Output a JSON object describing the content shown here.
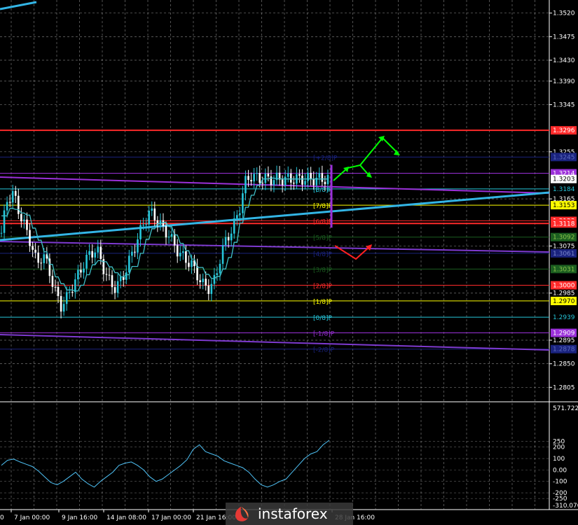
{
  "colors": {
    "background": "#000000",
    "grid": "#c0c0c0",
    "axis_text": "#ffffff",
    "candle_up": "#26c6da",
    "candle_down": "#ffffff",
    "ma": "#3fc0c8",
    "trend_cyan": "#33b5e5",
    "channel_purple": "#9b30d9",
    "level_red": "#ff2a2a",
    "forecast_green": "#00ff00",
    "forecast_red": "#ff2020",
    "cci": "#4fc3f7"
  },
  "chart_data": [
    {
      "type": "line",
      "title": "",
      "xlabel": "",
      "ylabel": "",
      "ylim": [
        1.278,
        1.3545
      ],
      "price_ticks": [
        "1.3520",
        "1.3475",
        "1.3430",
        "1.3390",
        "1.3345",
        "1.3255",
        "1.3165",
        "1.3075",
        "1.2985",
        "1.2895",
        "1.2850",
        "1.2805"
      ],
      "time_ticks": [
        "7 Jan 00:00",
        "9 Jan 16:00",
        "14 Jan 08:00",
        "17 Jan 00:00",
        "21 Jan 16:00",
        "28 Jan 16:00"
      ],
      "time_first_label": "0",
      "grid": true,
      "close_series": {
        "name": "",
        "x": [
          0,
          2,
          4,
          6,
          8,
          10,
          12,
          14,
          16,
          18,
          20,
          22,
          24,
          26,
          28,
          30,
          32,
          34,
          36,
          38,
          40,
          42,
          44,
          46,
          48,
          50,
          52,
          54,
          56,
          58,
          60,
          62,
          64,
          66,
          68,
          70,
          72,
          74,
          76,
          78,
          80,
          82,
          84,
          86,
          88,
          90,
          92,
          94,
          96,
          98,
          100,
          102,
          104,
          106,
          108,
          110
        ],
        "values": [
          1.31,
          1.3165,
          1.3175,
          1.314,
          1.311,
          1.308,
          1.304,
          1.306,
          1.303,
          1.299,
          1.296,
          1.2975,
          1.3,
          1.302,
          1.3045,
          1.306,
          1.307,
          1.304,
          1.301,
          1.2995,
          1.3005,
          1.303,
          1.306,
          1.309,
          1.312,
          1.314,
          1.313,
          1.311,
          1.31,
          1.308,
          1.306,
          1.305,
          1.304,
          1.302,
          1.3,
          1.2995,
          1.301,
          1.306,
          1.309,
          1.311,
          1.314,
          1.3195,
          1.321,
          1.3205,
          1.3203,
          1.3203,
          1.3203,
          1.3203,
          1.3203,
          1.3203,
          1.3203,
          1.3203,
          1.3203,
          1.3203,
          1.3203,
          1.3203
        ]
      },
      "murrey_levels": [
        {
          "label": "[+2/8]P",
          "price": 1.3245,
          "color": "#1a237e",
          "tag": "1.3245",
          "tag_bg": "#1a237e",
          "tag_fg": "#5c6bc0"
        },
        {
          "label": "[8/8]P",
          "price": 1.3184,
          "color": "#26c6da",
          "tag": "1.3184",
          "tag_bg": "#000000",
          "tag_fg": "#26c6da"
        },
        {
          "label": "[7/8]P",
          "price": 1.3153,
          "color": "#ffff00",
          "tag": "1.3153",
          "tag_bg": "#ffff00",
          "tag_fg": "#000000"
        },
        {
          "label": "[6/8]P",
          "price": 1.3123,
          "color": "#ff2a2a",
          "tag": "1.3123",
          "tag_bg": "#ff2a2a",
          "tag_fg": "#ffffff"
        },
        {
          "label": "[5/8]P",
          "price": 1.3092,
          "color": "#1b5e20",
          "tag": "1.3092",
          "tag_bg": "#1b5e20",
          "tag_fg": "#8bc34a"
        },
        {
          "label": "[4/8]P",
          "price": 1.3061,
          "color": "#1a237e",
          "tag": "1.3061",
          "tag_bg": "#1a237e",
          "tag_fg": "#7986cb"
        },
        {
          "label": "[3/8]P",
          "price": 1.3031,
          "color": "#1b5e20",
          "tag": "1.3031",
          "tag_bg": "#1b5e20",
          "tag_fg": "#8bc34a"
        },
        {
          "label": "[2/8]P",
          "price": 1.3,
          "color": "#ff2a2a",
          "tag": "1.3000",
          "tag_bg": "#ff2a2a",
          "tag_fg": "#ffffff"
        },
        {
          "label": "[1/8]P",
          "price": 1.297,
          "color": "#ffff00",
          "tag": "1.2970",
          "tag_bg": "#ffff00",
          "tag_fg": "#000000"
        },
        {
          "label": "[0/8]P",
          "price": 1.2939,
          "color": "#26c6da",
          "tag": "1.2939",
          "tag_bg": "#000000",
          "tag_fg": "#26c6da"
        },
        {
          "label": "[-1/8]P",
          "price": 1.2909,
          "color": "#9b30d9",
          "tag": "1.2909",
          "tag_bg": "#9b30d9",
          "tag_fg": "#ffffff"
        },
        {
          "label": "[-2/8]P",
          "price": 1.2878,
          "color": "#1a237e",
          "tag": "1.2878",
          "tag_bg": "#1a237e",
          "tag_fg": "#5c6bc0"
        }
      ],
      "extra_levels": [
        {
          "price": 1.3296,
          "color": "#ff2a2a",
          "tag": "1.3296",
          "tag_bg": "#ff2a2a",
          "tag_fg": "#ffffff"
        },
        {
          "price": 1.3118,
          "color": "#ff2a2a",
          "tag": "1.3118",
          "tag_bg": "#ff2a2a",
          "tag_fg": "#ffffff"
        },
        {
          "price": 1.3214,
          "color": "#9b30d9",
          "tag": "1.3214",
          "tag_bg": "#9b30d9",
          "tag_fg": "#ffffff"
        }
      ],
      "current_price": {
        "price": 1.3203,
        "tag": "1.3203",
        "tag_bg": "#ffffff",
        "tag_fg": "#000000"
      }
    },
    {
      "type": "line",
      "title": "",
      "ylim": [
        -310.07,
        571.7224
      ],
      "ticks": [
        "571.7224",
        "250",
        "200",
        "100",
        "0.00",
        "-100",
        "-200",
        "-250",
        "-310.0707"
      ],
      "series": {
        "name": "",
        "values": [
          40,
          85,
          95,
          70,
          50,
          30,
          -10,
          -60,
          -110,
          -130,
          -100,
          -60,
          -20,
          -80,
          -120,
          -150,
          -100,
          -60,
          -20,
          40,
          60,
          70,
          40,
          0,
          -60,
          -100,
          -80,
          -40,
          0,
          40,
          90,
          180,
          220,
          160,
          140,
          120,
          80,
          60,
          40,
          20,
          -20,
          -80,
          -130,
          -150,
          -130,
          -100,
          -80,
          -20,
          40,
          100,
          140,
          160,
          220,
          260
        ]
      }
    }
  ],
  "watermark": {
    "brand": "instaforex"
  }
}
